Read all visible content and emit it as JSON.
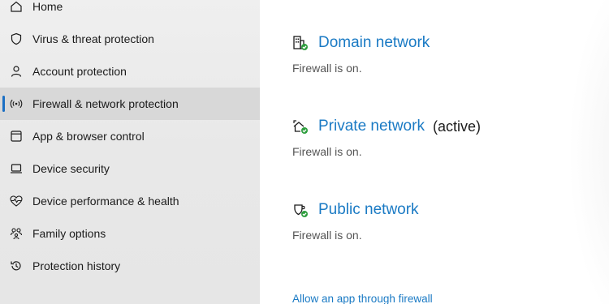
{
  "sidebar": {
    "items": [
      {
        "label": "Home",
        "icon": "home-icon"
      },
      {
        "label": "Virus & threat protection",
        "icon": "shield-icon"
      },
      {
        "label": "Account protection",
        "icon": "person-icon"
      },
      {
        "label": "Firewall & network protection",
        "icon": "antenna-icon",
        "active": true
      },
      {
        "label": "App & browser control",
        "icon": "browser-window-icon"
      },
      {
        "label": "Device security",
        "icon": "laptop-icon"
      },
      {
        "label": "Device performance & health",
        "icon": "heart-pulse-icon"
      },
      {
        "label": "Family options",
        "icon": "family-icon"
      },
      {
        "label": "Protection history",
        "icon": "history-icon"
      }
    ]
  },
  "main": {
    "networks": [
      {
        "title": "Domain network",
        "badge": "",
        "status": "Firewall is on.",
        "icon": "domain-network-icon"
      },
      {
        "title": "Private network",
        "badge": "(active)",
        "status": "Firewall is on.",
        "icon": "private-network-icon"
      },
      {
        "title": "Public network",
        "badge": "",
        "status": "Firewall is on.",
        "icon": "public-network-icon"
      }
    ],
    "allow_link": "Allow an app through firewall"
  },
  "colors": {
    "accent": "#1a7ac4",
    "check_green": "#2e9e3e",
    "active_bar": "#1a6fc4"
  }
}
